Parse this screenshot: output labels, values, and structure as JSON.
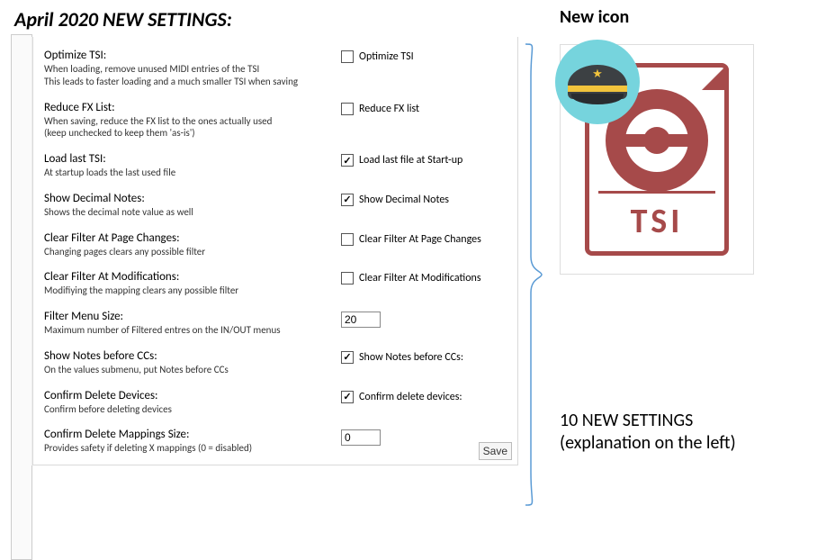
{
  "title": "April 2020 NEW SETTINGS:",
  "rightHeading": "New icon",
  "iconLabel": "TSI",
  "caption_line1": "10 NEW SETTINGS",
  "caption_line2": "(explanation on the left)",
  "saveLabel": "Save",
  "settings": [
    {
      "name": "Optimize TSI:",
      "desc": "When loading, remove unused MIDI entries of the TSI\nThis leads to faster loading and a much smaller TSI when saving",
      "control": "checkbox",
      "label": "Optimize TSI",
      "value": false
    },
    {
      "name": "Reduce FX List:",
      "desc": "When saving, reduce the FX list to the ones actually used\n(keep unchecked to keep them 'as-is')",
      "control": "checkbox",
      "label": "Reduce FX list",
      "value": false
    },
    {
      "name": "Load last TSI:",
      "desc": "At startup loads the last used file",
      "control": "checkbox",
      "label": "Load last file at Start-up",
      "value": true
    },
    {
      "name": "Show Decimal Notes:",
      "desc": "Shows the decimal note value as well",
      "control": "checkbox",
      "label": "Show Decimal Notes",
      "value": true
    },
    {
      "name": "Clear Filter At Page Changes:",
      "desc": "Changing pages clears any possible filter",
      "control": "checkbox",
      "label": "Clear Filter At Page Changes",
      "value": false
    },
    {
      "name": "Clear Filter At Modifications:",
      "desc": "Modifiying the mapping clears any possible filter",
      "control": "checkbox",
      "label": "Clear Filter At Modifications",
      "value": false
    },
    {
      "name": "Filter Menu Size:",
      "desc": "Maximum number of Filtered entres on the IN/OUT menus",
      "control": "text",
      "value": "20"
    },
    {
      "name": "Show Notes before CCs:",
      "desc": "On the values submenu, put Notes before CCs",
      "control": "checkbox",
      "label": "Show Notes before CCs:",
      "value": true
    },
    {
      "name": "Confirm Delete Devices:",
      "desc": "Confirm before deleting devices",
      "control": "checkbox",
      "label": "Confirm delete devices:",
      "value": true
    },
    {
      "name": "Confirm Delete Mappings Size:",
      "desc": "Provides safety if deleting X mappings (0 = disabled)",
      "control": "text",
      "value": "0"
    }
  ]
}
